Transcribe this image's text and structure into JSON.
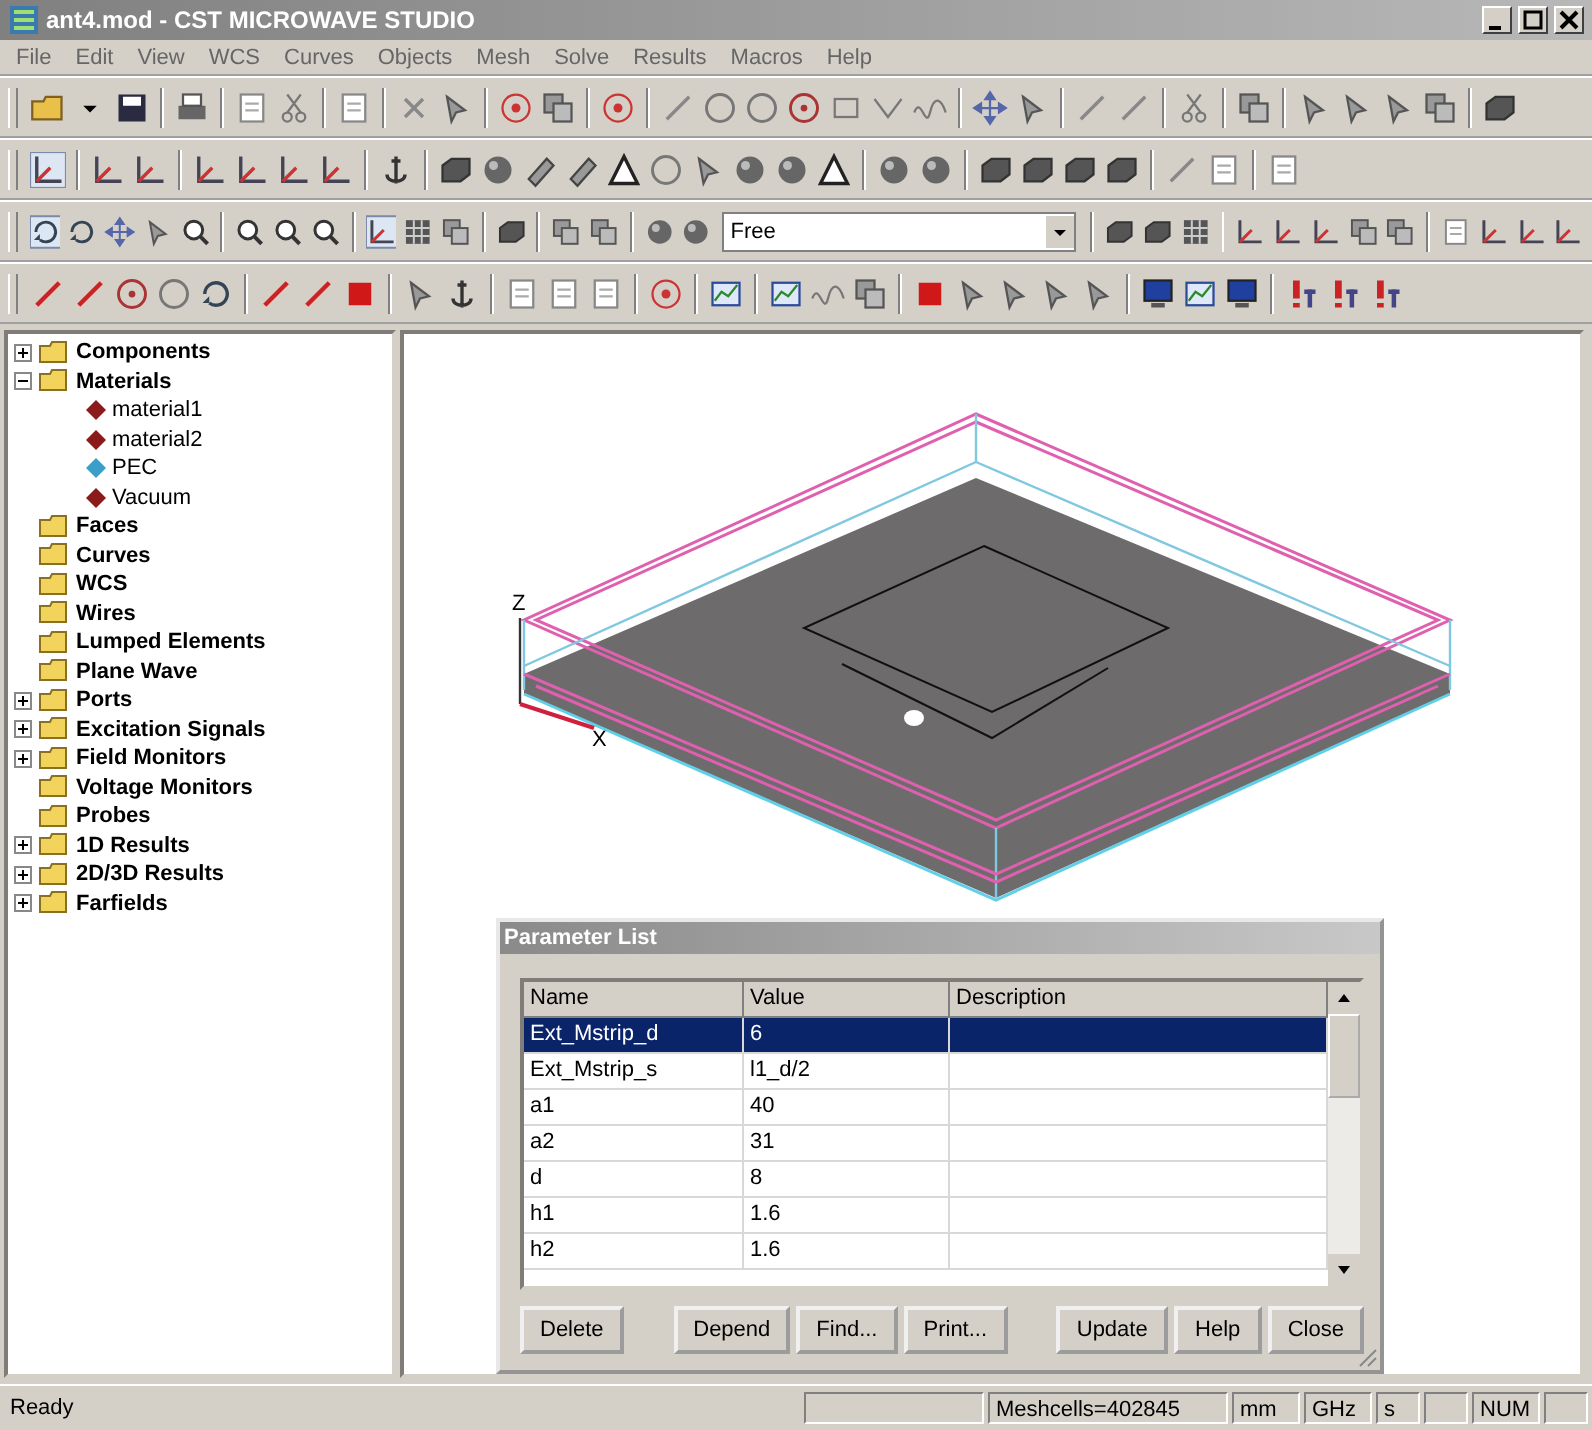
{
  "window": {
    "title": "ant4.mod - CST MICROWAVE STUDIO"
  },
  "menu": [
    "File",
    "Edit",
    "View",
    "WCS",
    "Curves",
    "Objects",
    "Mesh",
    "Solve",
    "Results",
    "Macros",
    "Help"
  ],
  "toolbar": {
    "combo_value": "Free"
  },
  "tree": [
    {
      "label": "Components",
      "kind": "folder",
      "expanded": false
    },
    {
      "label": "Materials",
      "kind": "folder",
      "expanded": true,
      "children": [
        {
          "label": "material1",
          "kind": "material",
          "color": "#8b1a1a"
        },
        {
          "label": "material2",
          "kind": "material",
          "color": "#8b1a1a"
        },
        {
          "label": "PEC",
          "kind": "material",
          "color": "#3a9fc8"
        },
        {
          "label": "Vacuum",
          "kind": "material",
          "color": "#8b1a1a"
        }
      ]
    },
    {
      "label": "Faces",
      "kind": "folder"
    },
    {
      "label": "Curves",
      "kind": "folder"
    },
    {
      "label": "WCS",
      "kind": "folder"
    },
    {
      "label": "Wires",
      "kind": "folder"
    },
    {
      "label": "Lumped Elements",
      "kind": "folder"
    },
    {
      "label": "Plane Wave",
      "kind": "folder"
    },
    {
      "label": "Ports",
      "kind": "folder",
      "expanded": false
    },
    {
      "label": "Excitation Signals",
      "kind": "folder",
      "expanded": false
    },
    {
      "label": "Field Monitors",
      "kind": "folder",
      "expanded": false
    },
    {
      "label": "Voltage Monitors",
      "kind": "folder"
    },
    {
      "label": "Probes",
      "kind": "folder"
    },
    {
      "label": "1D Results",
      "kind": "folder",
      "expanded": false
    },
    {
      "label": "2D/3D Results",
      "kind": "folder",
      "expanded": false
    },
    {
      "label": "Farfields",
      "kind": "folder",
      "expanded": false
    }
  ],
  "viewport": {
    "axis_labels": [
      "Z",
      "X"
    ]
  },
  "parameter_list": {
    "title": "Parameter List",
    "columns": [
      "Name",
      "Value",
      "Description"
    ],
    "rows": [
      {
        "name": "Ext_Mstrip_d",
        "value": "6",
        "selected": true
      },
      {
        "name": "Ext_Mstrip_s",
        "value": "l1_d/2",
        "selected": false
      },
      {
        "name": "a1",
        "value": "40",
        "selected": false
      },
      {
        "name": "a2",
        "value": "31",
        "selected": false
      },
      {
        "name": "d",
        "value": "8",
        "selected": false
      },
      {
        "name": "h1",
        "value": "1.6",
        "selected": false
      },
      {
        "name": "h2",
        "value": "1.6",
        "selected": false
      }
    ],
    "button_groups": [
      [
        "Delete"
      ],
      [
        "Depend",
        "Find...",
        "Print..."
      ],
      [
        "Update",
        "Help",
        "Close"
      ]
    ]
  },
  "status_bar": {
    "message": "Ready",
    "meshcells": "Meshcells=402845",
    "length_unit": "mm",
    "frequency_unit": "GHz",
    "time_unit": "s",
    "num_lock": "NUM"
  }
}
